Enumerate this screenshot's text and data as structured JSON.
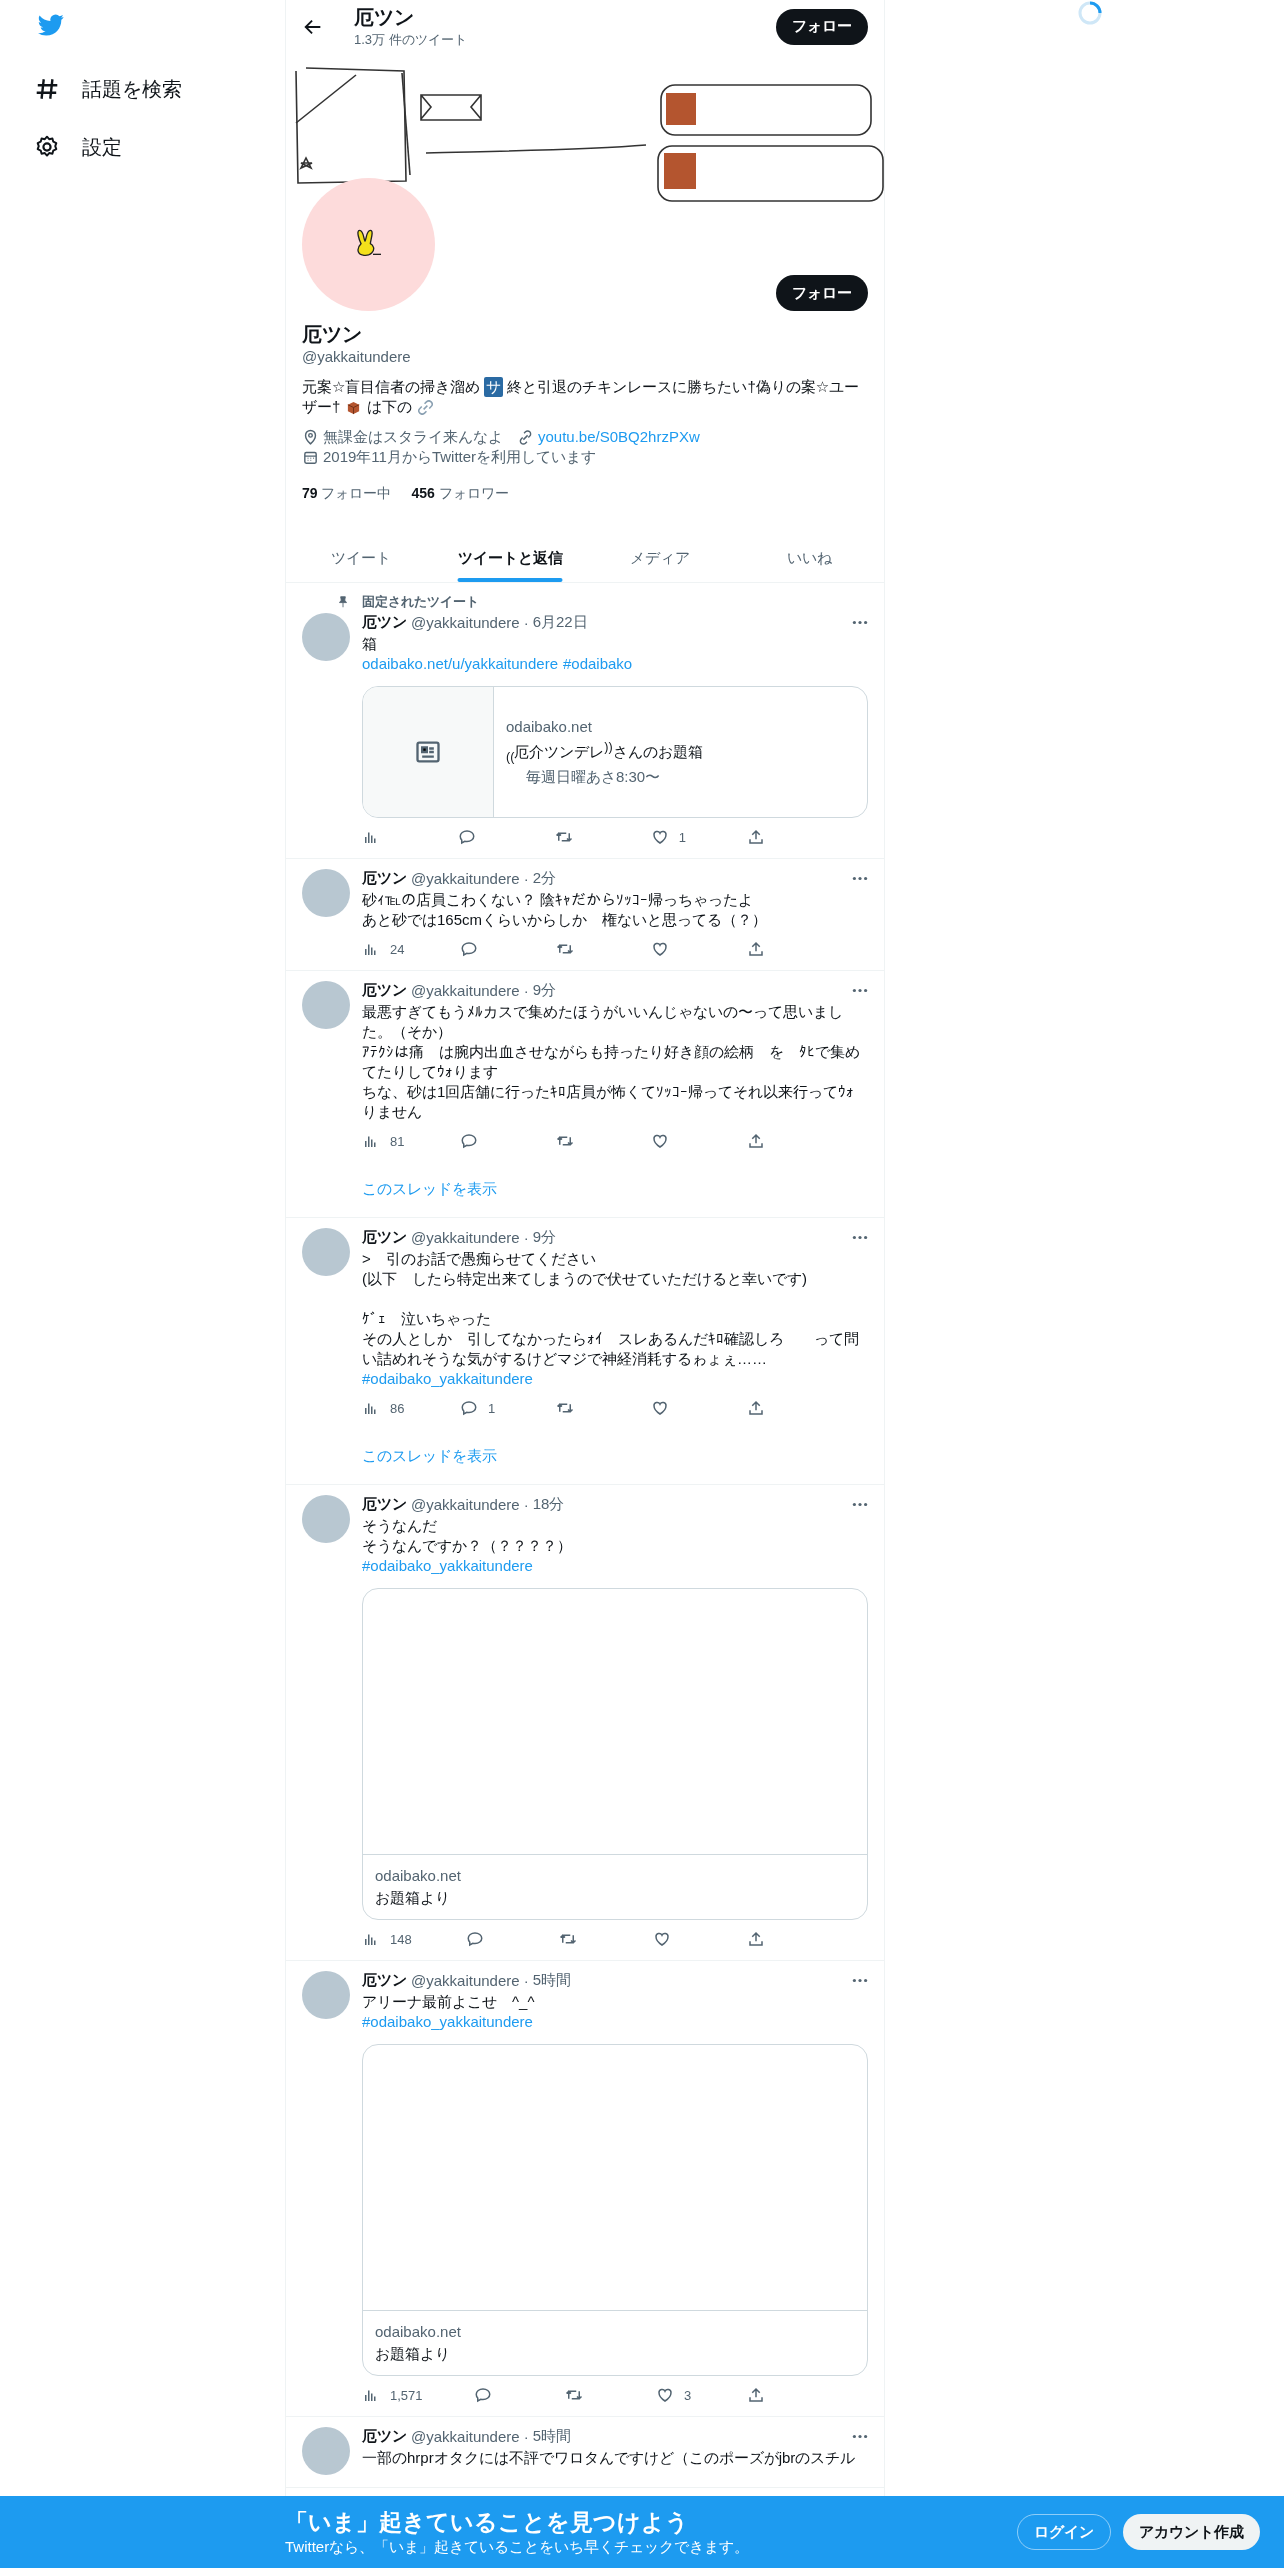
{
  "sidebar": {
    "items": [
      {
        "kind": "explore",
        "label": "話題を検索"
      },
      {
        "kind": "settings",
        "label": "設定"
      }
    ]
  },
  "header": {
    "title": "厄ツン",
    "subtitle": "1.3万 件のツイート",
    "button": "フォロー"
  },
  "profile": {
    "button": "フォロー",
    "name": "厄ツン",
    "handle": "@yakkaitundere",
    "bio": [
      [
        {
          "kind": "text",
          "text": "元案☆盲目信者の掃き溜め"
        },
        {
          "kind": "badge",
          "text": "サ"
        },
        {
          "kind": "text",
          "text": "終と引退のチキンレースに勝ちたい†偽りの案☆ユー"
        }
      ],
      [
        {
          "kind": "text",
          "text": "ザー†"
        },
        {
          "kind": "box"
        },
        {
          "kind": "text",
          "text": "は下の"
        },
        {
          "kind": "link"
        }
      ]
    ],
    "location": "無課金はスタライ来んなよ",
    "url": "youtu.be/S0BQ2hrzPXw",
    "joined": "2019年11月からTwitterを利用しています",
    "following_count": "79",
    "following_label": "フォロー中",
    "followers_count": "456",
    "followers_label": "フォロワー"
  },
  "tabs": [
    {
      "label": "ツイート",
      "selected": false
    },
    {
      "label": "ツイートと返信",
      "selected": true
    },
    {
      "label": "メディア",
      "selected": false
    },
    {
      "label": "いいね",
      "selected": false
    }
  ],
  "time_separator": "·",
  "tweets": [
    {
      "pinned_label": "固定されたツイート",
      "name": "厄ツン",
      "handle": "@yakkaitundere",
      "time": "6月22日",
      "body": [
        [
          "箱"
        ]
      ],
      "links": [
        "odaibako.net/u/yakkaitundere",
        "#odaibako"
      ],
      "card": {
        "kind": "summary",
        "domain": "odaibako.net",
        "title": "$_{((}$厄介ツンデレ$^{))}$さんのお題箱",
        "description": "毎週日曜あさ8:30〜"
      },
      "stats": {
        "likes": "1"
      }
    },
    {
      "name": "厄ツン",
      "handle": "@yakkaitundere",
      "time": "2分",
      "body": [
        [
          "砂ｨ℡の店員こわくない？ 陰ｷｬだからｿｯｺｰ帰っちゃったよ",
          "あと砂では165cmくらいからしか　権ないと思ってる（？）"
        ]
      ],
      "stats": {
        "views": "24"
      }
    },
    {
      "name": "厄ツン",
      "handle": "@yakkaitundere",
      "time": "9分",
      "body": [
        [
          "最悪すぎてもうﾒﾙカスで集めたほうがいいんじゃないの〜って思いました。（そか）",
          "ｱﾃｸｼは痛　は腕内出血させながらも持ったり好き顔の絵柄　を　ﾀﾋで集めてたりしてｳｫります",
          "ちな、砂は1回店舗に行ったｷﾛ店員が怖くてｿｯｺｰ帰ってそれ以来行ってｳｫりません"
        ]
      ],
      "stats": {
        "views": "81"
      },
      "thread_link": "このスレッドを表示"
    },
    {
      "name": "厄ツン",
      "handle": "@yakkaitundere",
      "time": "9分",
      "body": [
        [
          ">　引のお話で愚痴らせてください",
          "(以下　したら特定出来てしまうので伏せていただけると幸いです)"
        ],
        [
          "ｹﾞｪ　泣いちゃった",
          "その人としか　引してなかったらｫｲ　スレあるんだｷﾛ確認しろ　　って問い詰めれそうな気がするけどマジで神経消耗するゎょぇ……"
        ]
      ],
      "links": [
        "#odaibako_yakkaitundere"
      ],
      "stats": {
        "views": "86",
        "replies": "1"
      },
      "thread_link": "このスレッドを表示"
    },
    {
      "name": "厄ツン",
      "handle": "@yakkaitundere",
      "time": "18分",
      "body": [
        [
          "そうなんだ",
          "そうなんですか？（？？？？）"
        ]
      ],
      "links": [
        "#odaibako_yakkaitundere"
      ],
      "card": {
        "kind": "large",
        "domain": "odaibako.net",
        "title": "お題箱より"
      },
      "stats": {
        "views": "148"
      }
    },
    {
      "name": "厄ツン",
      "handle": "@yakkaitundere",
      "time": "5時間",
      "body": [
        [
          "アリーナ最前よこせ　^_^"
        ]
      ],
      "links": [
        "#odaibako_yakkaitundere"
      ],
      "card": {
        "kind": "large",
        "domain": "odaibako.net",
        "title": "お題箱より"
      },
      "stats": {
        "views": "1,571",
        "likes": "3"
      }
    },
    {
      "name": "厄ツン",
      "handle": "@yakkaitundere",
      "time": "5時間",
      "body": [
        [
          "一部のhrprオタクには不評でワロタんですけど（このポーズがjbrのスチル"
        ]
      ]
    }
  ],
  "bottom_bar": {
    "title": "「いま」起きていることを見つけよう",
    "subtitle": "Twitterなら、「いま」起きていることをいち早くチェックできます。",
    "login": "ログイン",
    "signup": "アカウント作成"
  }
}
